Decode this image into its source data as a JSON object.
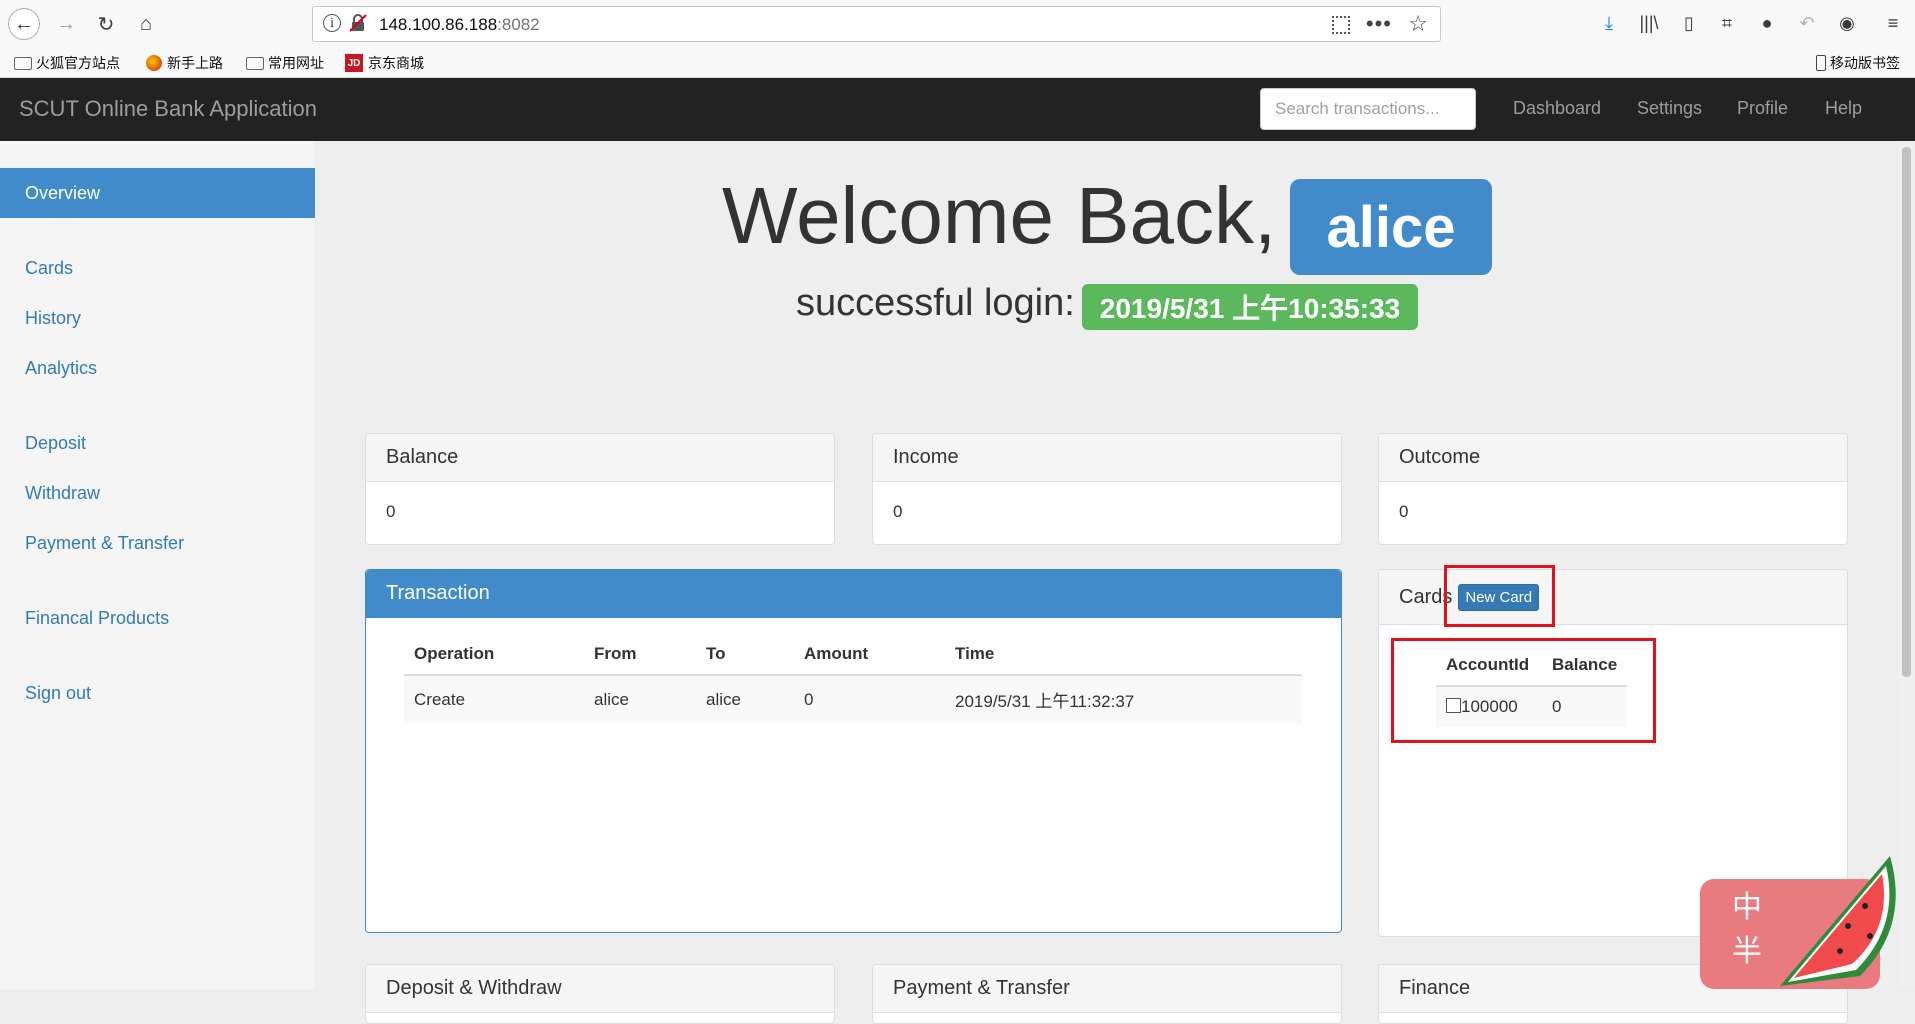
{
  "browser": {
    "url_host": "148.100.86.188",
    "url_port": ":8082",
    "bookmarks": [
      "火狐官方站点",
      "新手上路",
      "常用网址",
      "京东商城"
    ],
    "mobile_bookmarks": "移动版书签"
  },
  "navbar": {
    "brand": "SCUT Online Bank Application",
    "search_placeholder": "Search transactions...",
    "links": [
      "Dashboard",
      "Settings",
      "Profile",
      "Help"
    ]
  },
  "sidebar": {
    "items": [
      "Overview",
      "Cards",
      "History",
      "Analytics",
      "Deposit",
      "Withdraw",
      "Payment & Transfer",
      "Financal Products",
      "Sign out"
    ]
  },
  "welcome": {
    "greeting": "Welcome Back,",
    "username": "alice",
    "login_label": "successful login:",
    "login_time": "2019/5/31 上午10:35:33"
  },
  "summary": [
    {
      "title": "Balance",
      "value": "0"
    },
    {
      "title": "Income",
      "value": "0"
    },
    {
      "title": "Outcome",
      "value": "0"
    }
  ],
  "transaction": {
    "title": "Transaction",
    "columns": [
      "Operation",
      "From",
      "To",
      "Amount",
      "Time"
    ],
    "rows": [
      [
        "Create",
        "alice",
        "alice",
        "0",
        "2019/5/31 上午11:32:37"
      ]
    ]
  },
  "cards": {
    "title": "Cards",
    "new_card_label": "New Card",
    "columns": [
      "AccountId",
      "Balance"
    ],
    "rows": [
      [
        "100000",
        "0"
      ]
    ]
  },
  "bottom_panels": [
    "Deposit & Withdraw",
    "Payment & Transfer",
    "Finance"
  ],
  "sticker": {
    "text_line1": "中",
    "text_line2": "半"
  },
  "colors": {
    "primary": "#428bca",
    "success": "#5cb85c",
    "navbar": "#222222",
    "highlight": "#e0121a"
  }
}
